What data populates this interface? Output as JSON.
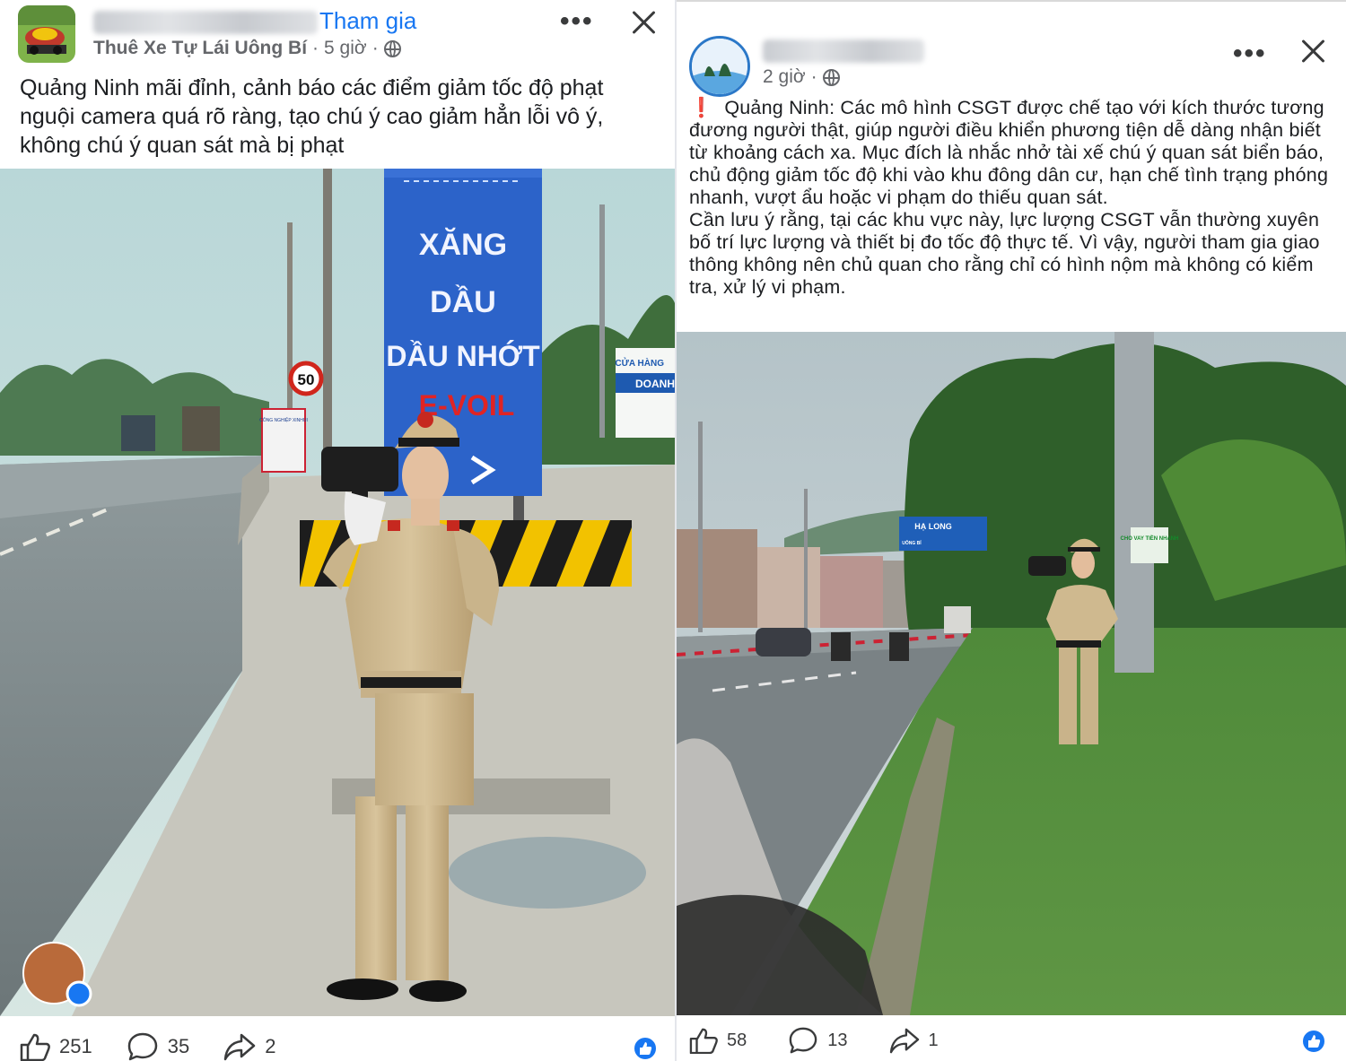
{
  "left_post": {
    "page_name": "Thuê Xe Tự Lái Uông Bí",
    "join_label": "Tham gia",
    "time_ago": "5 giờ",
    "more_label": "•••",
    "text": "Quảng Ninh mãi đỉnh, cảnh báo các điểm giảm tốc độ phạt\nnguội camera quá rõ ràng, tạo chú ý cao giảm hẳn lỗi vô ý,\nkhông chú ý quan sát mà bị phạt",
    "photo": {
      "sign_lines": [
        "XĂNG",
        "DẦU",
        "DẦU NHỚT"
      ],
      "brand": "E-VOIL",
      "speed_limit": "50",
      "side_sign_top": "CỬA HÀNG",
      "side_sign_mid": "DOANH",
      "billboard_title": "CÔNG NGHIỆP XINHUI"
    },
    "likes": "251",
    "comments": "35",
    "shares": "2"
  },
  "right_post": {
    "time_ago": "2 giờ",
    "more_label": "•••",
    "warning_mark": "❗",
    "text": "Quảng Ninh: Các mô hình CSGT được chế tạo với kích thước tương đương người thật, giúp người điều khiển phương tiện dễ dàng nhận biết từ khoảng cách xa. Mục đích là nhắc nhở tài xế chú ý quan sát biển báo, chủ động giảm tốc độ khi vào khu đông dân cư, hạn chế tình trạng phóng nhanh, vượt ẩu hoặc vi phạm do thiếu quan sát.\nCần lưu ý rằng, tại các khu vực này, lực lượng CSGT vẫn thường xuyên bố trí lực lượng và thiết bị đo tốc độ thực tế. Vì vậy, người tham gia giao thông không nên chủ quan cho rằng chỉ có hình nộm mà không có kiểm tra, xử lý vi phạm.",
    "photo": {
      "road_sign": "HẠ LONG",
      "road_sign_left": "UÔNG BÍ",
      "pole_ad": "CHO VAY TIỀN NHANH"
    },
    "likes": "58",
    "comments": "13",
    "shares": "1"
  },
  "colors": {
    "link": "#1877f2",
    "text": "#1c1e21",
    "secondary": "#65676b"
  }
}
